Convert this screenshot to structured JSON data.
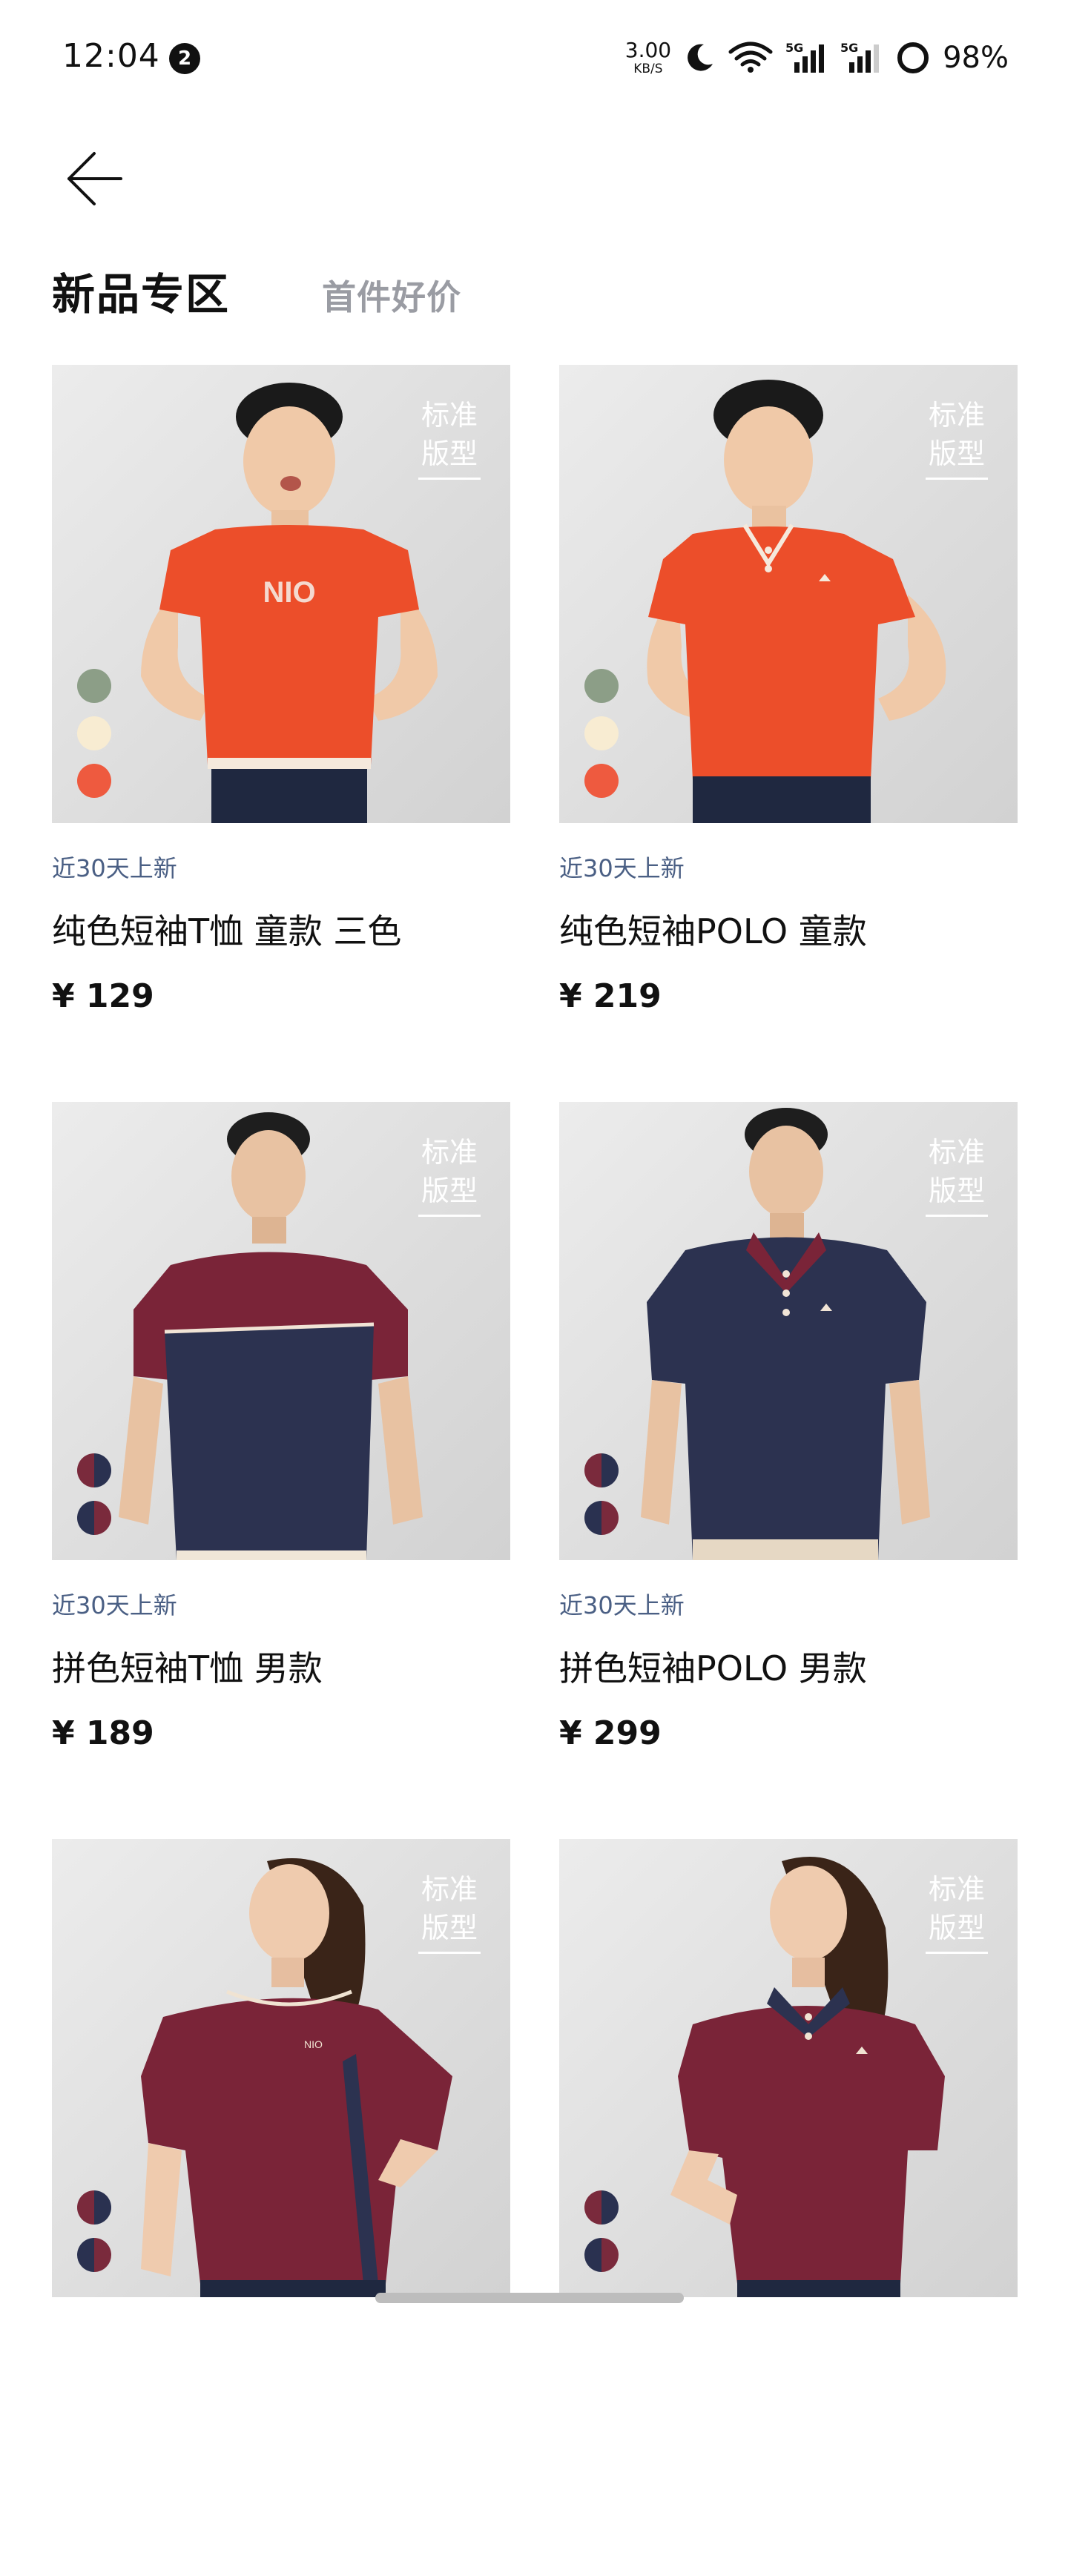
{
  "status_bar": {
    "time": "12:04",
    "notification_count": "2",
    "net_speed": "3.00",
    "net_speed_unit": "KB/S",
    "battery": "98%"
  },
  "header": {
    "tabs": [
      {
        "label": "新品专区",
        "active": true
      },
      {
        "label": "首件好价",
        "active": false
      }
    ]
  },
  "products": [
    {
      "fit_line1": "标准",
      "fit_line2": "版型",
      "tag": "近30天上新",
      "title": "纯色短袖T恤 童款 三色",
      "price": "¥ 129",
      "swatches": [
        "#8c9e87",
        "#f8ecd2",
        "#ee5a3f"
      ],
      "shirt_color": "#ec4e2a",
      "model": "child-tee"
    },
    {
      "fit_line1": "标准",
      "fit_line2": "版型",
      "tag": "近30天上新",
      "title": "纯色短袖POLO 童款",
      "price": "¥ 219",
      "swatches": [
        "#8c9e87",
        "#f8ecd2",
        "#ee5a3f"
      ],
      "shirt_color": "#ec4e2a",
      "model": "child-polo"
    },
    {
      "fit_line1": "标准",
      "fit_line2": "版型",
      "tag": "近30天上新",
      "title": "拼色短袖T恤 男款",
      "price": "¥ 189",
      "swatches": [
        "#7a2a3c",
        "#2a3150"
      ],
      "shirt_color": "#2c3250",
      "model": "man-tee"
    },
    {
      "fit_line1": "标准",
      "fit_line2": "版型",
      "tag": "近30天上新",
      "title": "拼色短袖POLO 男款",
      "price": "¥ 299",
      "swatches": [
        "#7a2a3c",
        "#2a3150"
      ],
      "shirt_color": "#2c3250",
      "model": "man-polo"
    },
    {
      "fit_line1": "标准",
      "fit_line2": "版型",
      "tag": "",
      "title": "",
      "price": "",
      "swatches": [
        "#7a2a3c",
        "#2a3150"
      ],
      "shirt_color": "#7a2438",
      "model": "woman-tee"
    },
    {
      "fit_line1": "标准",
      "fit_line2": "版型",
      "tag": "",
      "title": "",
      "price": "",
      "swatches": [
        "#7a2a3c",
        "#2a3150"
      ],
      "shirt_color": "#7a2438",
      "model": "woman-polo"
    }
  ],
  "logo_text": "NIO"
}
